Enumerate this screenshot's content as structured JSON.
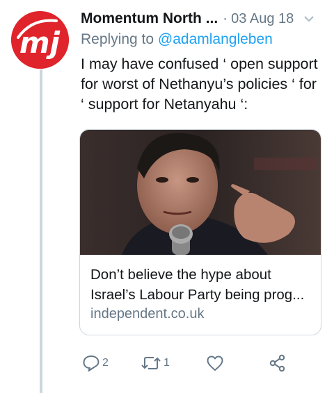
{
  "tweet": {
    "author_name": "Momentum North ...",
    "separator": "·",
    "date": "03 Aug 18",
    "replying_prefix": "Replying to ",
    "replying_handle": "@adamlangleben",
    "text_lines": [
      "I may have confused ‘ open support",
      "for worst of Nethanyu’s policies ‘ for",
      "‘ support for Netanyahu ‘:"
    ]
  },
  "avatar": {
    "icon": "momentum-logo-icon",
    "color": "#e0242b"
  },
  "card": {
    "image_icon": "man-speaking-photo",
    "title_lines": [
      "Don’t believe the hype about",
      "Israel’s Labour Party being prog..."
    ],
    "domain": "independent.co.uk"
  },
  "actions": {
    "reply_count": "2",
    "retweet_count": "1",
    "like_count": "",
    "share_count": ""
  },
  "colors": {
    "text": "#14171a",
    "secondary": "#657786",
    "link": "#1da1f2",
    "thread_line": "#ccd6dd"
  }
}
